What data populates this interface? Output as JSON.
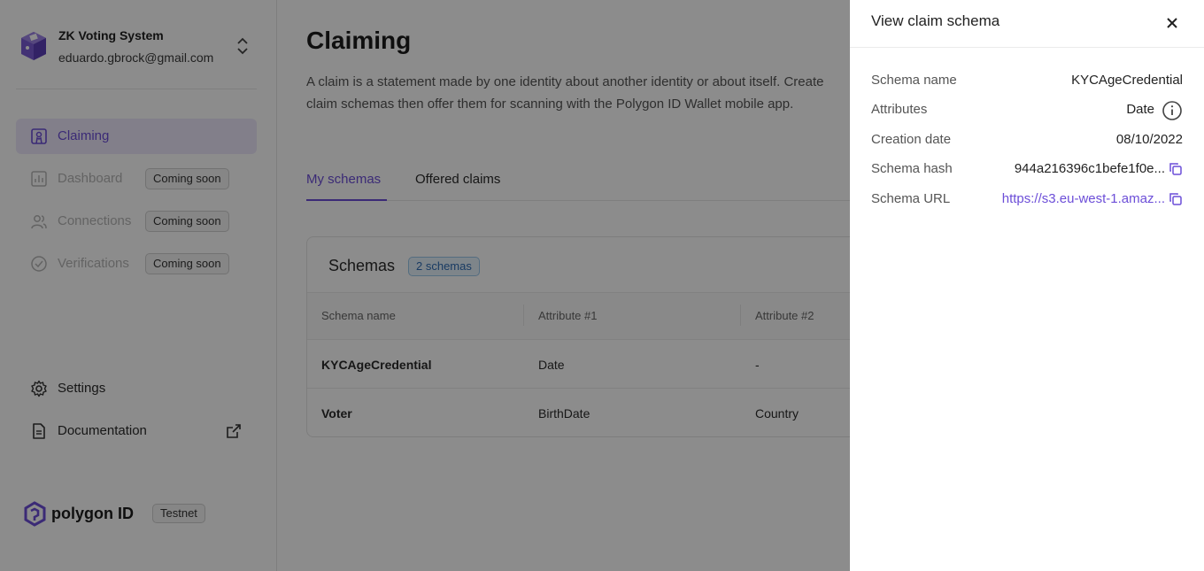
{
  "org": {
    "name": "ZK Voting System",
    "email": "eduardo.gbrock@gmail.com"
  },
  "sidebar": {
    "items": [
      {
        "label": "Claiming",
        "icon": "claim-icon",
        "state": "active"
      },
      {
        "label": "Dashboard",
        "icon": "chart-icon",
        "state": "disabled",
        "badge": "Coming soon"
      },
      {
        "label": "Connections",
        "icon": "users-icon",
        "state": "disabled",
        "badge": "Coming soon"
      },
      {
        "label": "Verifications",
        "icon": "check-circle-icon",
        "state": "disabled",
        "badge": "Coming soon"
      }
    ],
    "footer": [
      {
        "label": "Settings",
        "icon": "gear-icon"
      },
      {
        "label": "Documentation",
        "icon": "document-icon"
      }
    ],
    "brand": "polygon ID",
    "env_badge": "Testnet"
  },
  "main": {
    "title": "Claiming",
    "description": "A claim is a statement made by one identity about another identity or about itself. Create claim schemas then offer them for scanning with the Polygon ID Wallet mobile app.",
    "tabs": [
      {
        "label": "My schemas",
        "active": true
      },
      {
        "label": "Offered claims",
        "active": false
      }
    ],
    "card": {
      "title": "Schemas",
      "count_badge": "2 schemas",
      "columns": [
        "Schema name",
        "Attribute #1",
        "Attribute #2"
      ],
      "rows": [
        [
          "KYCAgeCredential",
          "Date",
          "-"
        ],
        [
          "Voter",
          "BirthDate",
          "Country"
        ]
      ]
    }
  },
  "drawer": {
    "title": "View claim schema",
    "fields": [
      {
        "label": "Schema name",
        "value": "KYCAgeCredential"
      },
      {
        "label": "Attributes",
        "value": "Date"
      },
      {
        "label": "Creation date",
        "value": "08/10/2022"
      },
      {
        "label": "Schema hash",
        "value": "944a216396c1befe1f0e..."
      },
      {
        "label": "Schema URL",
        "value": "https://s3.eu-west-1.amaz..."
      }
    ]
  },
  "colors": {
    "accent": "#6c4ed8",
    "active_bg": "#ede8fb",
    "overlay": "rgba(0,0,0,0.45)"
  }
}
